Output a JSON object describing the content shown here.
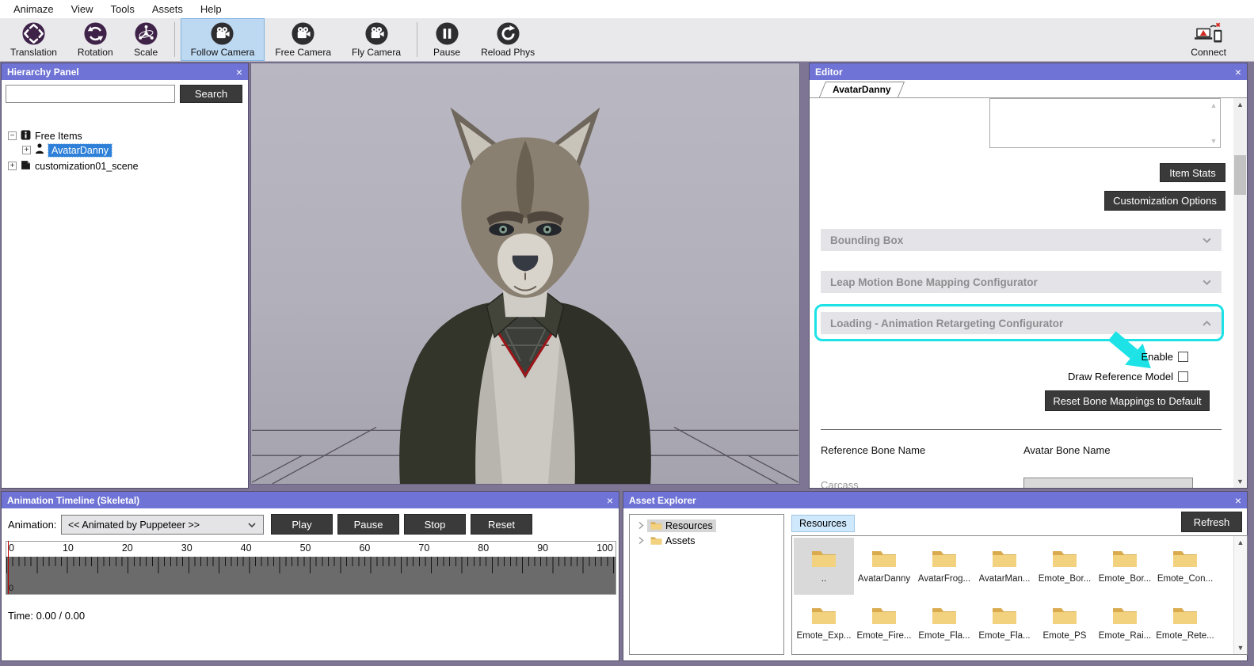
{
  "menu": {
    "items": [
      "Animaze",
      "View",
      "Tools",
      "Assets",
      "Help"
    ]
  },
  "toolbar": {
    "items": [
      {
        "label": "Translation",
        "active": false
      },
      {
        "label": "Rotation",
        "active": false
      },
      {
        "label": "Scale",
        "active": false
      },
      {
        "label": "Follow Camera",
        "active": true
      },
      {
        "label": "Free Camera",
        "active": false
      },
      {
        "label": "Fly Camera",
        "active": false
      },
      {
        "label": "Pause",
        "active": false
      },
      {
        "label": "Reload Phys",
        "active": false
      }
    ],
    "connect_label": "Connect"
  },
  "hierarchy_panel": {
    "title": "Hierarchy Panel",
    "search_value": "",
    "search_button": "Search",
    "tree": [
      {
        "label": "Free Items",
        "expander": "-",
        "selected": false
      },
      {
        "label": "AvatarDanny",
        "expander": "+",
        "selected": true
      },
      {
        "label": "customization01_scene",
        "expander": "+",
        "selected": false
      }
    ]
  },
  "editor": {
    "title": "Editor",
    "tab": "AvatarDanny",
    "item_stats_button": "Item Stats",
    "customization_options_button": "Customization Options",
    "sections": [
      {
        "label": "Bounding Box",
        "state": "collapsed",
        "highlighted": false
      },
      {
        "label": "Leap Motion Bone Mapping Configurator",
        "state": "collapsed",
        "highlighted": false
      },
      {
        "label": "Loading - Animation Retargeting Configurator",
        "state": "expanded",
        "highlighted": true
      }
    ],
    "enable_label": "Enable",
    "enable_checked": false,
    "draw_reference_label": "Draw Reference Model",
    "draw_reference_checked": false,
    "reset_button": "Reset Bone Mappings to Default",
    "reference_bone_header": "Reference Bone Name",
    "avatar_bone_header": "Avatar Bone Name",
    "clipped_row_label": "Carcass"
  },
  "timeline": {
    "title": "Animation Timeline (Skeletal)",
    "animation_label": "Animation:",
    "animation_value": "<< Animated by Puppeteer >>",
    "play_button": "Play",
    "pause_button": "Pause",
    "stop_button": "Stop",
    "reset_button": "Reset",
    "ruler_numbers": [
      "0",
      "10",
      "20",
      "30",
      "40",
      "50",
      "60",
      "70",
      "80",
      "90",
      "100"
    ],
    "track_start_label": "0",
    "time_label": "Time: 0.00 / 0.00"
  },
  "asset_explorer": {
    "title": "Asset Explorer",
    "tree": [
      {
        "label": "Resources",
        "selected": true
      },
      {
        "label": "Assets",
        "selected": false
      }
    ],
    "active_tab": "Resources",
    "refresh_button": "Refresh",
    "folders": [
      {
        "label": "..",
        "selected": true
      },
      {
        "label": "AvatarDanny"
      },
      {
        "label": "AvatarFrog..."
      },
      {
        "label": "AvatarMan..."
      },
      {
        "label": "Emote_Bor..."
      },
      {
        "label": "Emote_Bor..."
      },
      {
        "label": "Emote_Con..."
      },
      {
        "label": "Emote_Exp..."
      },
      {
        "label": "Emote_Fire..."
      },
      {
        "label": "Emote_Fla..."
      },
      {
        "label": "Emote_Fla..."
      },
      {
        "label": "Emote_PS"
      },
      {
        "label": "Emote_Rai..."
      },
      {
        "label": "Emote_Rete..."
      }
    ]
  },
  "colors": {
    "titlebar": "#6e73d5",
    "window_background": "#7d7593",
    "highlight_cyan": "#1de2e6",
    "selection_blue": "#2e80d8",
    "dark_button": "#3a3a3a",
    "toolbar_purple_icon": "#3f2248",
    "folder_yellow": "#f2d27e"
  }
}
